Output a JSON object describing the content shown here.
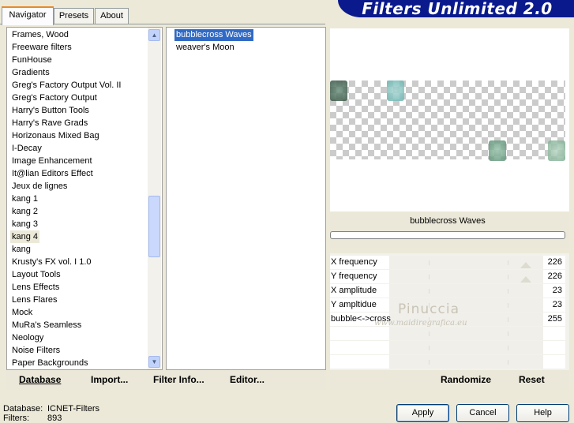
{
  "banner": {
    "title": "Filters Unlimited 2.0"
  },
  "tabs": [
    {
      "label": "Navigator",
      "active": true
    },
    {
      "label": "Presets",
      "active": false
    },
    {
      "label": "About",
      "active": false
    }
  ],
  "categories": [
    "Frames, Wood",
    "Freeware filters",
    "FunHouse",
    "Gradients",
    "Greg's Factory Output Vol. II",
    "Greg's Factory Output",
    "Harry's Button Tools",
    "Harry's Rave Grads",
    "Horizonaus Mixed Bag",
    "I-Decay",
    "Image Enhancement",
    "It@lian Editors Effect",
    "Jeux de lignes",
    "kang 1",
    "kang 2",
    "kang 3",
    "kang 4",
    "kang",
    "Krusty's FX vol. I 1.0",
    "Layout Tools",
    "Lens Effects",
    "Lens Flares",
    "Mock",
    "MuRa's Seamless",
    "Neology",
    "Noise Filters",
    "Paper Backgrounds"
  ],
  "selected_category": "kang 4",
  "filters": [
    {
      "label": "bubblecross Waves",
      "selected": true
    },
    {
      "label": "weaver's Moon",
      "selected": false
    }
  ],
  "left_buttons": {
    "database": "Database",
    "import": "Import...",
    "filter_info": "Filter Info...",
    "editor": "Editor..."
  },
  "preview": {
    "filter_name": "bubblecross Waves"
  },
  "params": [
    {
      "label": "X frequency",
      "value": "226",
      "level": 0.886
    },
    {
      "label": "Y frequency",
      "value": "226",
      "level": 0.886
    },
    {
      "label": "X amplitude",
      "value": "23",
      "level": 0.09
    },
    {
      "label": "Y ampltidue",
      "value": "23",
      "level": 0.09
    },
    {
      "label": "bubble<->cross",
      "value": "255",
      "level": 1.0
    }
  ],
  "right_buttons": {
    "randomize": "Randomize",
    "reset": "Reset"
  },
  "watermark": {
    "name": "Pinuccia",
    "site": "www.maidiregrafica.eu"
  },
  "status": {
    "database_label": "Database:",
    "database_value": "ICNET-Filters",
    "filters_label": "Filters:",
    "filters_value": "893"
  },
  "dialog_buttons": {
    "apply": "Apply",
    "cancel": "Cancel",
    "help": "Help"
  },
  "colors": {
    "selection": "#316ac5",
    "banner": "#0a1a8c",
    "panel": "#ece9d8"
  }
}
